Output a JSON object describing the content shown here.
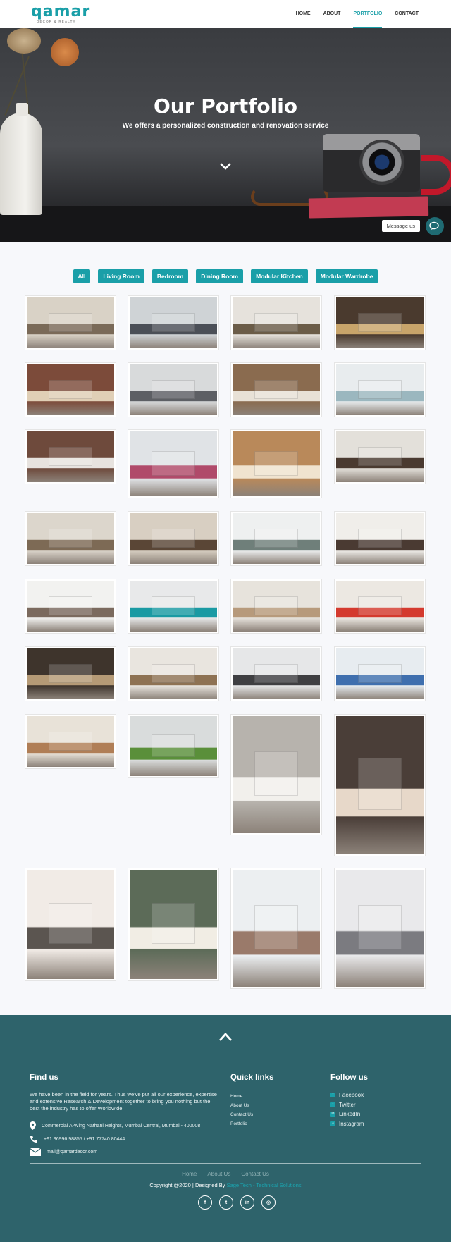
{
  "brand": {
    "logo_text": "qamar",
    "tagline": "DECOR & REALTY"
  },
  "nav": [
    {
      "label": "HOME",
      "active": false
    },
    {
      "label": "ABOUT",
      "active": false
    },
    {
      "label": "PORTFOLIO",
      "active": true
    },
    {
      "label": "CONTACT",
      "active": false
    }
  ],
  "hero": {
    "title": "Our Portfolio",
    "subtitle": "We offers a personalized construction and renovation service",
    "message_label": "Message us"
  },
  "filters": [
    "All",
    "Living Room",
    "Bedroom",
    "Dining Room",
    "Modular Kitchen",
    "Modular Wardrobe"
  ],
  "gallery": {
    "items": [
      {
        "category": "Living Room"
      },
      {
        "category": "Living Room"
      },
      {
        "category": "Living Room"
      },
      {
        "category": "Living Room"
      },
      {
        "category": "Living Room"
      },
      {
        "category": "Living Room"
      },
      {
        "category": "Bedroom"
      },
      {
        "category": "Living Room"
      },
      {
        "category": "Bedroom"
      },
      {
        "category": "Bedroom"
      },
      {
        "category": "Bedroom"
      },
      {
        "category": "Dining Room"
      },
      {
        "category": "Dining Room"
      },
      {
        "category": "Dining Room"
      },
      {
        "category": "Dining Room"
      },
      {
        "category": "Modular Kitchen"
      },
      {
        "category": "Modular Kitchen"
      },
      {
        "category": "Modular Kitchen"
      },
      {
        "category": "Modular Kitchen"
      },
      {
        "category": "Modular Kitchen"
      },
      {
        "category": "Modular Kitchen"
      },
      {
        "category": "Modular Wardrobe"
      },
      {
        "category": "Modular Wardrobe"
      },
      {
        "category": "Living Room"
      },
      {
        "category": "Modular Wardrobe"
      },
      {
        "category": "Living Room"
      },
      {
        "category": "Living Room"
      },
      {
        "category": "Living Room"
      },
      {
        "category": "Bedroom"
      },
      {
        "category": "Bedroom"
      },
      {
        "category": "Bedroom"
      },
      {
        "category": "Modular Wardrobe"
      }
    ]
  },
  "footer": {
    "find_us": {
      "title": "Find us",
      "text": "We have been in the field for years. Thus we've put all our experience, expertise and extensive Research & Development together to bring you nothing but the best the industry has to offer Worldwide.",
      "address": "Commercial A-Wing Nathani Heights, Mumbai Central, Mumbai - 400008",
      "phone": "+91 96996 98855 / +91 77740 80444",
      "email": "mail@qamardecor.com"
    },
    "quick_links": {
      "title": "Quick links",
      "items": [
        "Home",
        "About Us",
        "Contact Us",
        "Portfolio"
      ]
    },
    "follow_us": {
      "title": "Follow us",
      "items": [
        "Facebook",
        "Twitter",
        "LinkedIn",
        "Instagram"
      ]
    },
    "bottom_links": [
      "Home",
      "About Us",
      "Contact Us"
    ],
    "copyright_prefix": "Copyright @2020 | Designed By ",
    "copyright_brand": "Sage Tech - Technical Solutions"
  },
  "colors": {
    "accent": "#1a9fa8",
    "footer_bg": "#2e636b",
    "hero_bg": "#3a3c40"
  }
}
